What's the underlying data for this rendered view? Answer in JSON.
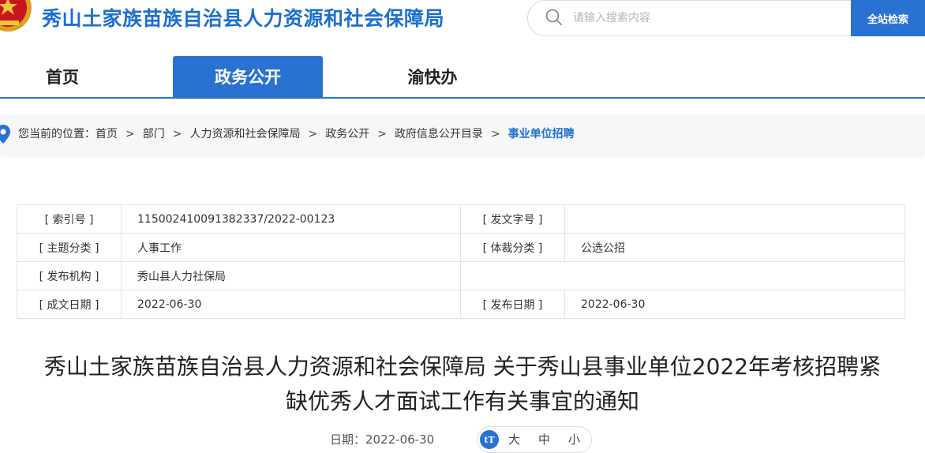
{
  "header": {
    "site_title": "秀山土家族苗族自治县人力资源和社会保障局",
    "search_placeholder": "请输入搜索内容",
    "search_button": "全站检索"
  },
  "nav": [
    {
      "label": "首页",
      "active": false
    },
    {
      "label": "政务公开",
      "active": true
    },
    {
      "label": "渝快办",
      "active": false
    }
  ],
  "breadcrumb": {
    "prefix": "您当前的位置：",
    "items": [
      "首页",
      "部门",
      "人力资源和社会保障局",
      "政务公开",
      "政府信息公开目录",
      "事业单位招聘"
    ],
    "separator": ">"
  },
  "meta": {
    "index_label": "[ 索引号 ]",
    "index_value": "11500241009138233​7/2022-00123",
    "doc_no_label": "[ 发文字号 ]",
    "doc_no_value": "",
    "topic_label": "[ 主题分类 ]",
    "topic_value": "人事工作",
    "genre_label": "[ 体裁分类 ]",
    "genre_value": "公选公招",
    "publisher_label": "[ 发布机构 ]",
    "publisher_value": "秀山县人力社保局",
    "created_label": "[ 成文日期 ]",
    "created_value": "2022-06-30",
    "published_label": "[ 发布日期 ]",
    "published_value": "2022-06-30"
  },
  "article": {
    "title_line1": "秀山土家族苗族自治县人力资源和社会保障局 关于秀山县事业单位2022年考核招聘紧",
    "title_line2": "缺优秀人才面试工作有关事宜的通知",
    "date_text": "日期：2022-06-30",
    "font_icon_text": "tT",
    "font_large": "大",
    "font_medium": "中",
    "font_small": "小"
  },
  "colors": {
    "brand_blue": "#2a72d2",
    "title_blue": "#1d6fd0"
  }
}
